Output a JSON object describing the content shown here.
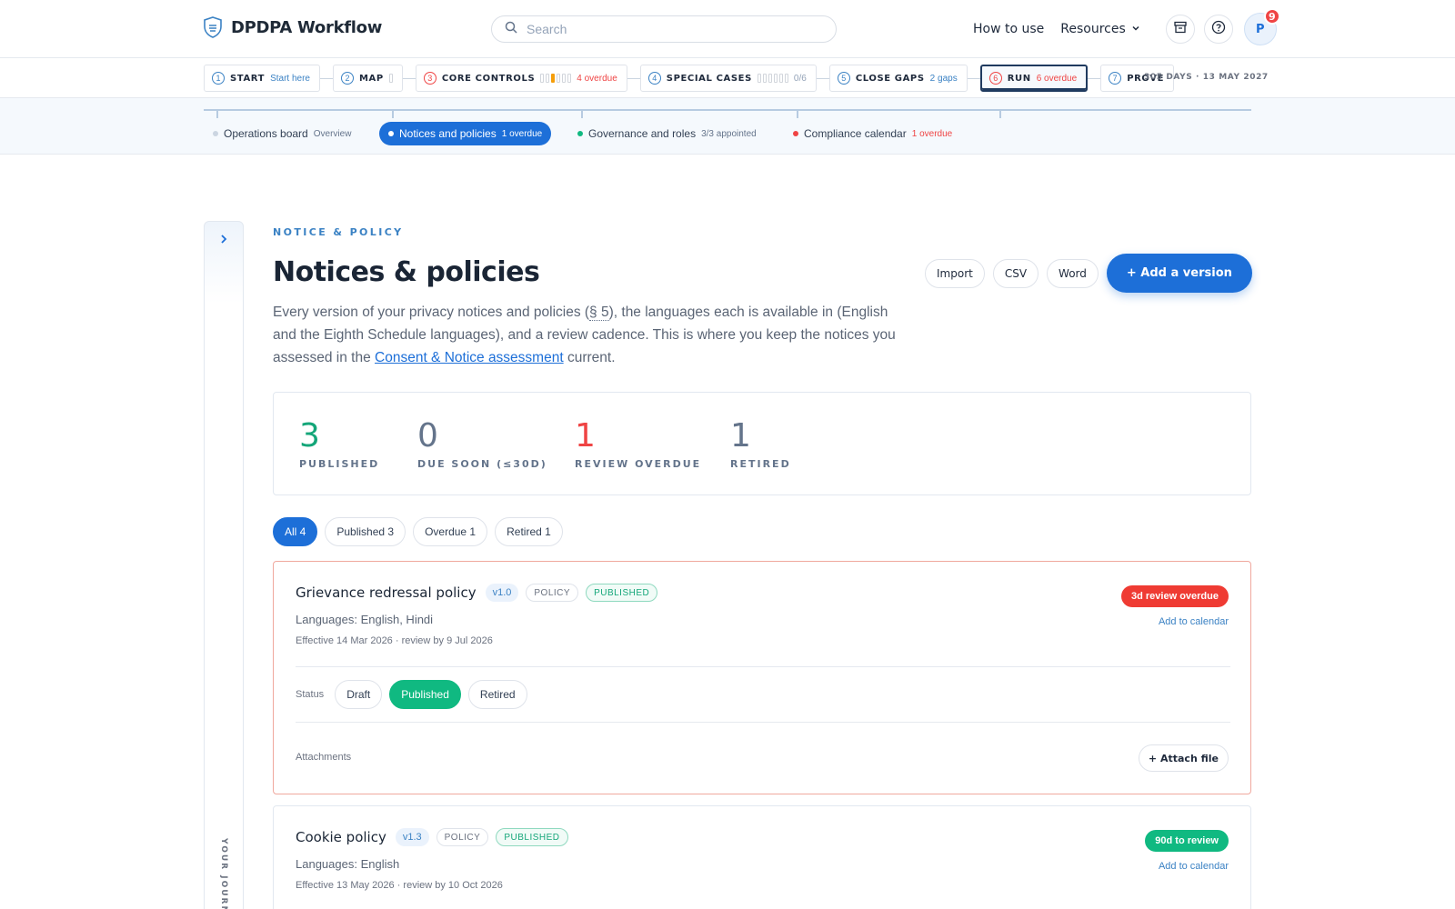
{
  "header": {
    "app_title": "DPDPA Workflow",
    "search_placeholder": "Search",
    "how_to_use": "How to use",
    "resources": "Resources",
    "avatar_initial": "P",
    "notification_count": "9"
  },
  "steps": [
    {
      "num": "1",
      "title": "START",
      "sub": "Start here"
    },
    {
      "num": "2",
      "title": "MAP",
      "sub": ""
    },
    {
      "num": "3",
      "title": "CORE CONTROLS",
      "sub": "4 overdue"
    },
    {
      "num": "4",
      "title": "SPECIAL CASES",
      "sub": "0/6"
    },
    {
      "num": "5",
      "title": "CLOSE GAPS",
      "sub": "2 gaps"
    },
    {
      "num": "6",
      "title": "RUN",
      "sub": "6 overdue"
    },
    {
      "num": "7",
      "title": "PROVE",
      "sub": ""
    }
  ],
  "deadline": "305 DAYS · 13 MAY 2027",
  "subtabs": [
    {
      "label": "Operations board",
      "meta": "Overview"
    },
    {
      "label": "Notices and policies",
      "meta": "1 overdue"
    },
    {
      "label": "Governance and roles",
      "meta": "3/3 appointed"
    },
    {
      "label": "Compliance calendar",
      "meta": "1 overdue"
    }
  ],
  "journey_label": "YOUR JOURNEY",
  "page": {
    "eyebrow": "NOTICE & POLICY",
    "title": "Notices & policies",
    "intro_1": "Every version of your privacy notices and policies (",
    "intro_ref": "§ 5",
    "intro_2": "), the languages each is available in (English and the Eighth Schedule languages), and a review cadence. This is where you keep the notices you assessed in the ",
    "intro_link": "Consent & Notice assessment",
    "intro_3": " current."
  },
  "actions": {
    "import": "Import",
    "csv": "CSV",
    "word": "Word",
    "add_version": "+ Add a version"
  },
  "stats": [
    {
      "value": "3",
      "label": "PUBLISHED",
      "color": "#14a679"
    },
    {
      "value": "0",
      "label": "DUE SOON (≤30D)",
      "color": "#64748b"
    },
    {
      "value": "1",
      "label": "REVIEW OVERDUE",
      "color": "#ef4444"
    },
    {
      "value": "1",
      "label": "RETIRED",
      "color": "#64748b"
    }
  ],
  "filters": [
    "All 4",
    "Published 3",
    "Overdue 1",
    "Retired 1"
  ],
  "cards": [
    {
      "title": "Grievance redressal policy",
      "version": "v1.0",
      "type": "POLICY",
      "state": "PUBLISHED",
      "languages": "Languages: English, Hindi",
      "dates": "Effective 14 Mar 2026 · review by 9 Jul 2026",
      "due": "3d review overdue",
      "calendar": "Add to calendar",
      "status_label": "Status",
      "status_options": [
        "Draft",
        "Published",
        "Retired"
      ],
      "status_selected": "Published",
      "attachments_label": "Attachments",
      "attach_button": "+ Attach file"
    },
    {
      "title": "Cookie policy",
      "version": "v1.3",
      "type": "POLICY",
      "state": "PUBLISHED",
      "languages": "Languages: English",
      "dates": "Effective 13 May 2026 · review by 10 Oct 2026",
      "due": "90d to review",
      "calendar": "Add to calendar"
    }
  ],
  "colors": {
    "accent": "#1d6fd8",
    "success": "#10b981",
    "danger": "#ef4444",
    "warning": "#f59e0b"
  }
}
